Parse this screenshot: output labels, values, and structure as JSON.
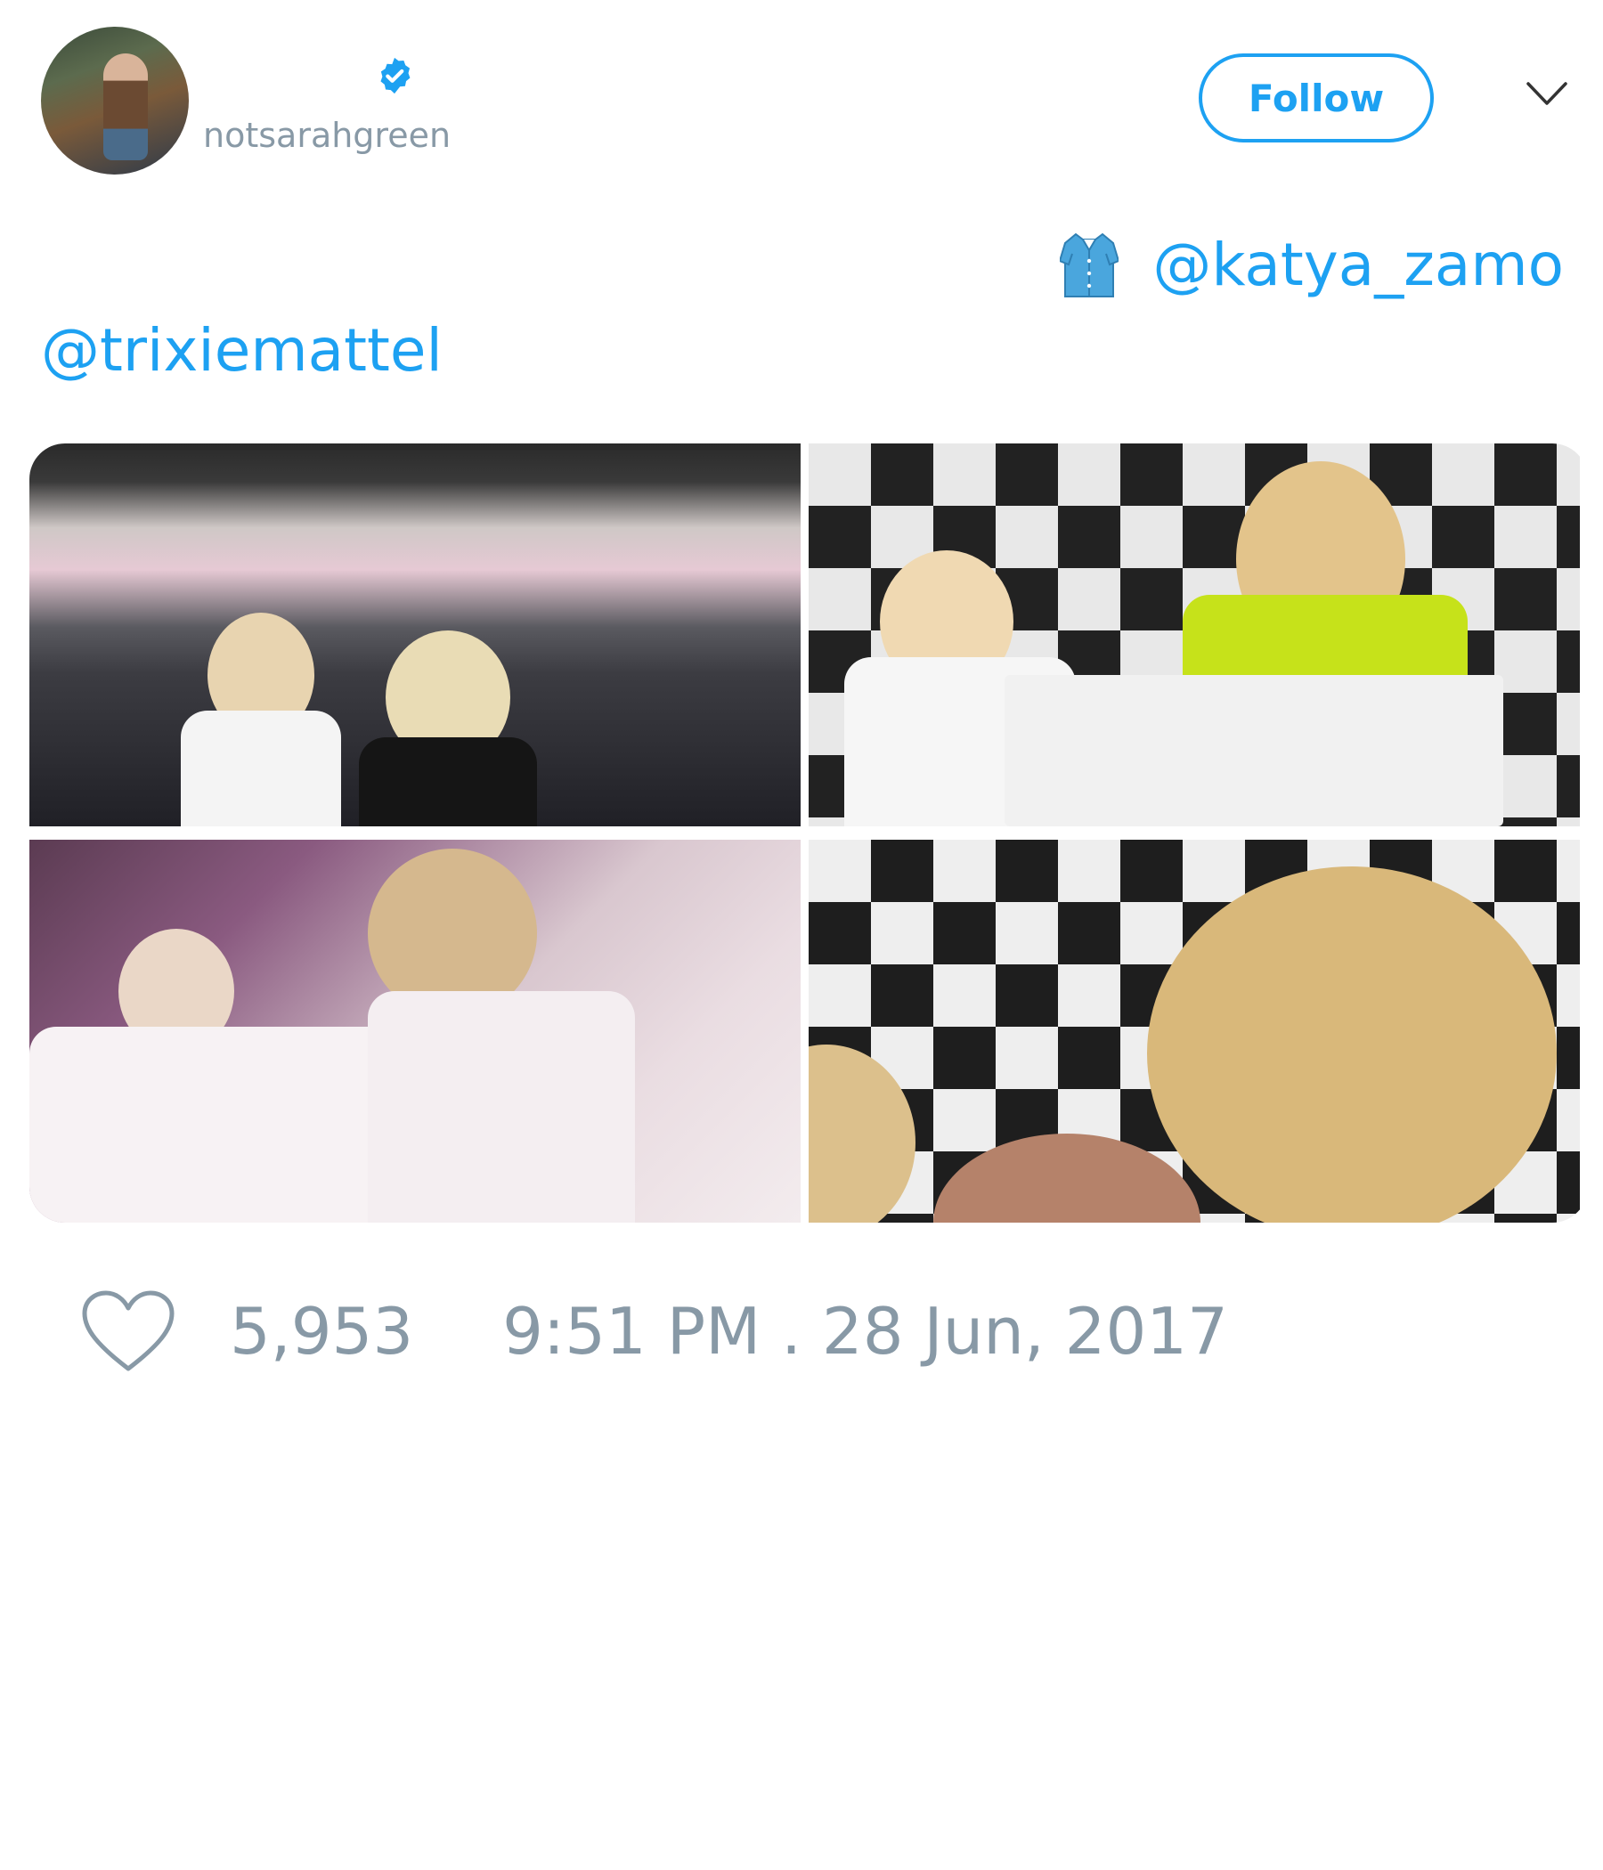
{
  "user": {
    "handle": "notsarahgreen",
    "verified": true
  },
  "header": {
    "follow_label": "Follow",
    "menu_icon": "chevron-down-icon"
  },
  "tweet": {
    "emoji": "shirt-icon",
    "mentions": [
      "@katya_zamo",
      "@trixiemattel"
    ]
  },
  "media": {
    "photo_count": 4
  },
  "footer": {
    "like_icon": "heart-icon",
    "like_count": "5,953",
    "timestamp": "9:51 PM . 28 Jun, 2017"
  },
  "colors": {
    "accent": "#1da1f2",
    "muted": "#8899a6"
  }
}
